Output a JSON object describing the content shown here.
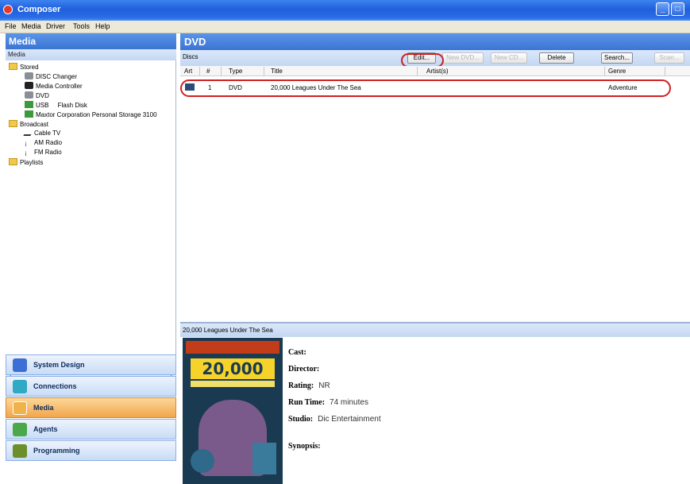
{
  "window": {
    "title": "Composer"
  },
  "menu": [
    "File",
    "Media",
    "Driver",
    "Tools",
    "Help"
  ],
  "left_panel": {
    "header": "Media",
    "subheader": "Media",
    "tree": [
      {
        "label": "Stored",
        "icon": "folder-icon"
      },
      {
        "label": "DISC Changer",
        "icon": "disc-changer-icon"
      },
      {
        "label": "Media Controller",
        "icon": "media-controller-icon"
      },
      {
        "label": "DVD",
        "icon": "dvd-drive-icon"
      },
      {
        "label": "USB     Flash Disk",
        "icon": "usb-icon"
      },
      {
        "label": "Maxtor Corporation Personal Storage 3100",
        "icon": "usb-icon"
      },
      {
        "label": "Broadcast",
        "icon": "folder-icon"
      },
      {
        "label": "Cable TV",
        "icon": "cable-icon"
      },
      {
        "label": "AM Radio",
        "icon": "antenna-icon"
      },
      {
        "label": "FM Radio",
        "icon": "antenna-icon"
      },
      {
        "label": "Playlists",
        "icon": "folder-icon"
      }
    ],
    "nav": [
      {
        "label": "System Design",
        "color": "#3b6fd6",
        "active": false
      },
      {
        "label": "Connections",
        "color": "#2fa9c4",
        "active": false
      },
      {
        "label": "Media",
        "color": "#f1b24a",
        "active": true
      },
      {
        "label": "Agents",
        "color": "#4aa84a",
        "active": false
      },
      {
        "label": "Programming",
        "color": "#6b8f2a",
        "active": false
      }
    ]
  },
  "right_panel": {
    "header": "DVD",
    "toolbar_label": "Discs",
    "buttons": {
      "edit": "Edit...",
      "new_dvd": "New DVD...",
      "new_cd": "New CD...",
      "delete": "Delete",
      "search": "Search...",
      "scan": "Scan..."
    },
    "columns": [
      "Art",
      "#",
      "Type",
      "Title",
      "Artist(s)",
      "Genre"
    ],
    "rows": [
      {
        "num": "1",
        "type": "DVD",
        "title": "20,000 Leagues Under The Sea",
        "artist": "",
        "genre": "Adventure"
      }
    ],
    "detail": {
      "heading": "20,000 Leagues Under The Sea",
      "cover_text": "20,000",
      "cast_label": "Cast:",
      "director_label": "Director:",
      "rating_label": "Rating:",
      "rating_value": "NR",
      "runtime_label": "Run Time:",
      "runtime_value": "74 minutes",
      "studio_label": "Studio:",
      "studio_value": "Dic Entertainment",
      "synopsis_label": "Synopsis:"
    }
  },
  "colors": {
    "titlebar": "#1f5fdc",
    "panel_header": "#3b74d4",
    "highlight_circle": "#d02020",
    "active_nav": "#f2a64a"
  }
}
